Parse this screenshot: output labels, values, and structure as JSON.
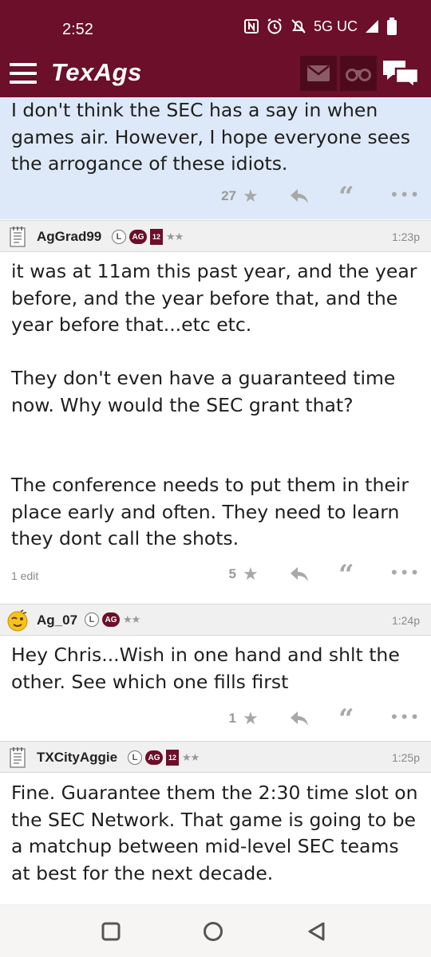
{
  "status_bar": {
    "time": "2:52",
    "network": "5G UC",
    "icons": [
      "nfc-icon",
      "alarm-icon",
      "mute-icon",
      "signal-icon",
      "battery-icon"
    ]
  },
  "header": {
    "logo": "TexAgs",
    "icons": [
      "menu-icon",
      "mail-icon",
      "binoculars-icon",
      "chat-icon"
    ],
    "brand_color": "#6b0f2a"
  },
  "posts": [
    {
      "id": "post-0",
      "text": "I don't think the SEC has a say in when games air. However, I hope everyone sees the arrogance of these idiots.",
      "stars": "27",
      "highlighted": true
    },
    {
      "id": "post-1",
      "user": "AgGrad99",
      "badges": [
        "L",
        "AG",
        "12",
        "★★"
      ],
      "time": "1:23p",
      "avatar": "notepad-icon",
      "text": "it was at 11am this past year, and the year before, and the year before that, and the year before that...etc etc.\n\nThey don't even have a guaranteed time now. Why would the SEC grant that?\n\n\nThe conference needs to put them in their place early and often. They need to learn they dont call the shots.",
      "edit": "1 edit",
      "stars": "5"
    },
    {
      "id": "post-2",
      "user": "Ag_07",
      "badges": [
        "L",
        "AG",
        "★★"
      ],
      "time": "1:24p",
      "avatar": "winking-face-icon",
      "text": "Hey Chris...Wish in one hand and shlt the other. See which one fills first",
      "stars": "1"
    },
    {
      "id": "post-3",
      "user": "TXCityAggie",
      "badges": [
        "L",
        "AG",
        "12",
        "★★"
      ],
      "time": "1:25p",
      "avatar": "notepad-icon",
      "text": "Fine. Guarantee them the 2:30 time slot on the SEC Network. That game is going to be a matchup between mid-level SEC teams at best for the next decade."
    }
  ],
  "nav_bar": {
    "icons": [
      "recents-square-icon",
      "home-circle-icon",
      "back-triangle-icon"
    ]
  }
}
